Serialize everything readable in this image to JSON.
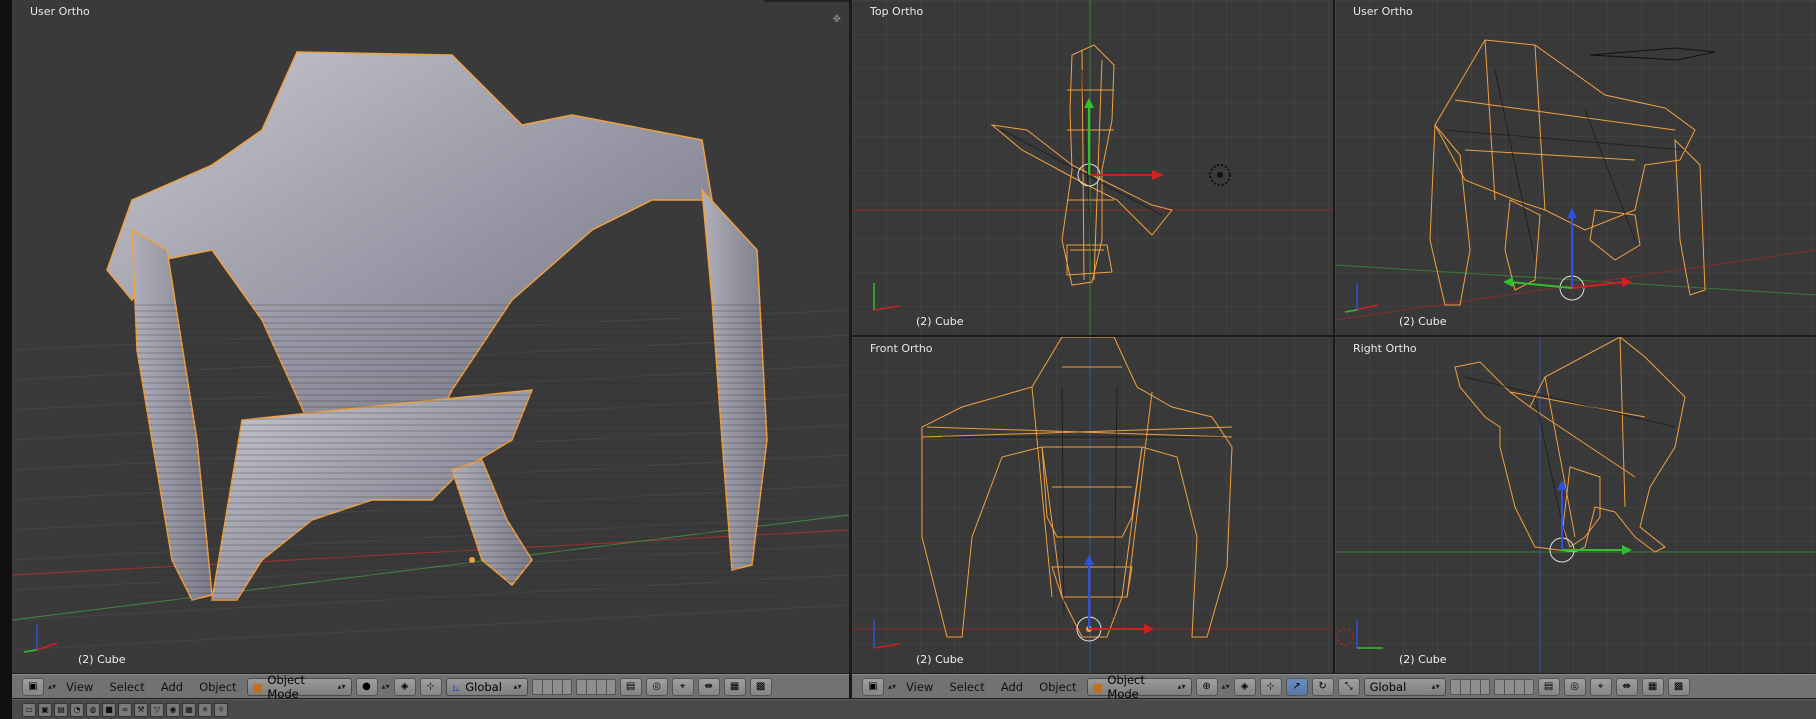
{
  "viewports": {
    "main": {
      "label": "User Ortho",
      "object": "(2) Cube"
    },
    "top": {
      "label": "Top Ortho",
      "object": "(2) Cube"
    },
    "user2": {
      "label": "User Ortho",
      "object": "(2) Cube"
    },
    "front": {
      "label": "Front Ortho",
      "object": "(2) Cube"
    },
    "right": {
      "label": "Right Ortho",
      "object": "(2) Cube"
    }
  },
  "header_left": {
    "menus": [
      "View",
      "Select",
      "Add",
      "Object"
    ],
    "mode": "Object Mode",
    "orientation": "Global"
  },
  "header_right": {
    "menus": [
      "View",
      "Select",
      "Add",
      "Object"
    ],
    "mode": "Object Mode",
    "orientation": "Global"
  },
  "colors": {
    "wire": "#f0a040",
    "axis_x": "#d02020",
    "axis_y": "#30c030",
    "axis_z": "#3050e0",
    "header_bg": "#727272",
    "viewport_bg": "#393939"
  },
  "icons": [
    "editor-type-icon",
    "viewport-shading-icon",
    "pivot-icon",
    "manipulator-icon",
    "layers-icon",
    "render-icon"
  ]
}
